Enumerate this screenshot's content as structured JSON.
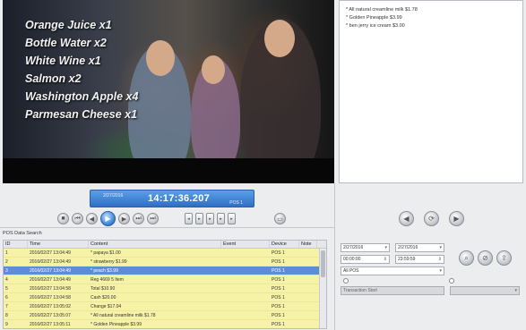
{
  "overlay_items": [
    "Orange Juice x1",
    "Bottle Water x2",
    "White Wine x1",
    "Salmon x2",
    "Washington Apple x4",
    "Parmesan Cheese x1"
  ],
  "receipt_lines": [
    "* All natural creamline milk $1.78",
    "* Golden Pineapple $3.99",
    "* ben jerry ice cream $3.00"
  ],
  "timebar": {
    "date": "2/27/2016",
    "clock": "14:17:36.207",
    "pos": "POS 1"
  },
  "search_title": "POS Data Search",
  "table": {
    "headers": [
      "ID",
      "Time",
      "Content",
      "Event",
      "Device",
      "Note"
    ],
    "rows": [
      [
        "1",
        "2016/02/27 13:04:49",
        "* papaya $1.00",
        "",
        "POS 1",
        ""
      ],
      [
        "2",
        "2016/02/27 13:04:49",
        "* strawberry $1.99",
        "",
        "POS 1",
        ""
      ],
      [
        "3",
        "2016/02/27 13:04:49",
        "* peach $3.99",
        "",
        "POS 1",
        ""
      ],
      [
        "4",
        "2016/02/27 13:04:49",
        "Reg 4669 5 Item",
        "",
        "POS 1",
        ""
      ],
      [
        "5",
        "2016/02/27 13:04:58",
        "Total $10.90",
        "",
        "POS 1",
        ""
      ],
      [
        "6",
        "2016/02/27 13:04:58",
        "Cash $20.00",
        "",
        "POS 1",
        ""
      ],
      [
        "7",
        "2016/02/27 13:05:02",
        "Change $17.04",
        "",
        "POS 1",
        ""
      ],
      [
        "8",
        "2016/02/27 13:05:07",
        "* All natural creamline milk $1.78",
        "",
        "POS 1",
        ""
      ],
      [
        "9",
        "2016/02/27 13:05:11",
        "* Golden Pineapple $3.99",
        "",
        "POS 1",
        ""
      ],
      [
        "10",
        "2016/02/27 13:05:15",
        "* ben jerry ice cream $3.00",
        "",
        "POS 1",
        ""
      ]
    ]
  },
  "filters": {
    "start_date": "2/27/2016",
    "end_date": "2/27/2016",
    "start_time": "00:00:00",
    "end_time": "23:59:59",
    "device": "All POS",
    "transaction": "Transaction Start"
  },
  "colors": {
    "row_highlight": "#f6f2a6",
    "row_selected": "#5a8fd8",
    "timebar": "#2f6fc4"
  }
}
